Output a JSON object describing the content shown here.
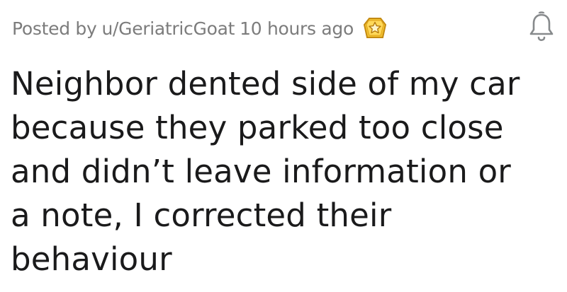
{
  "post": {
    "meta": {
      "posted_by": "Posted by",
      "username": "u/GeriatricGoat",
      "time_ago": "10 hours ago",
      "award_icon": "gold-star-award-icon"
    },
    "notification_icon": "bell-icon",
    "title_lines": [
      "Neighbor dented side of my car",
      "because they parked too close",
      "and didn’t leave information or",
      "a note, I corrected their",
      "behaviour"
    ]
  },
  "colors": {
    "meta_text": "#7c7c7c",
    "title_text": "#1a1a1b",
    "award_gold": "#f2c230",
    "award_outline": "#c48a12",
    "bell_stroke": "#878a8c"
  }
}
